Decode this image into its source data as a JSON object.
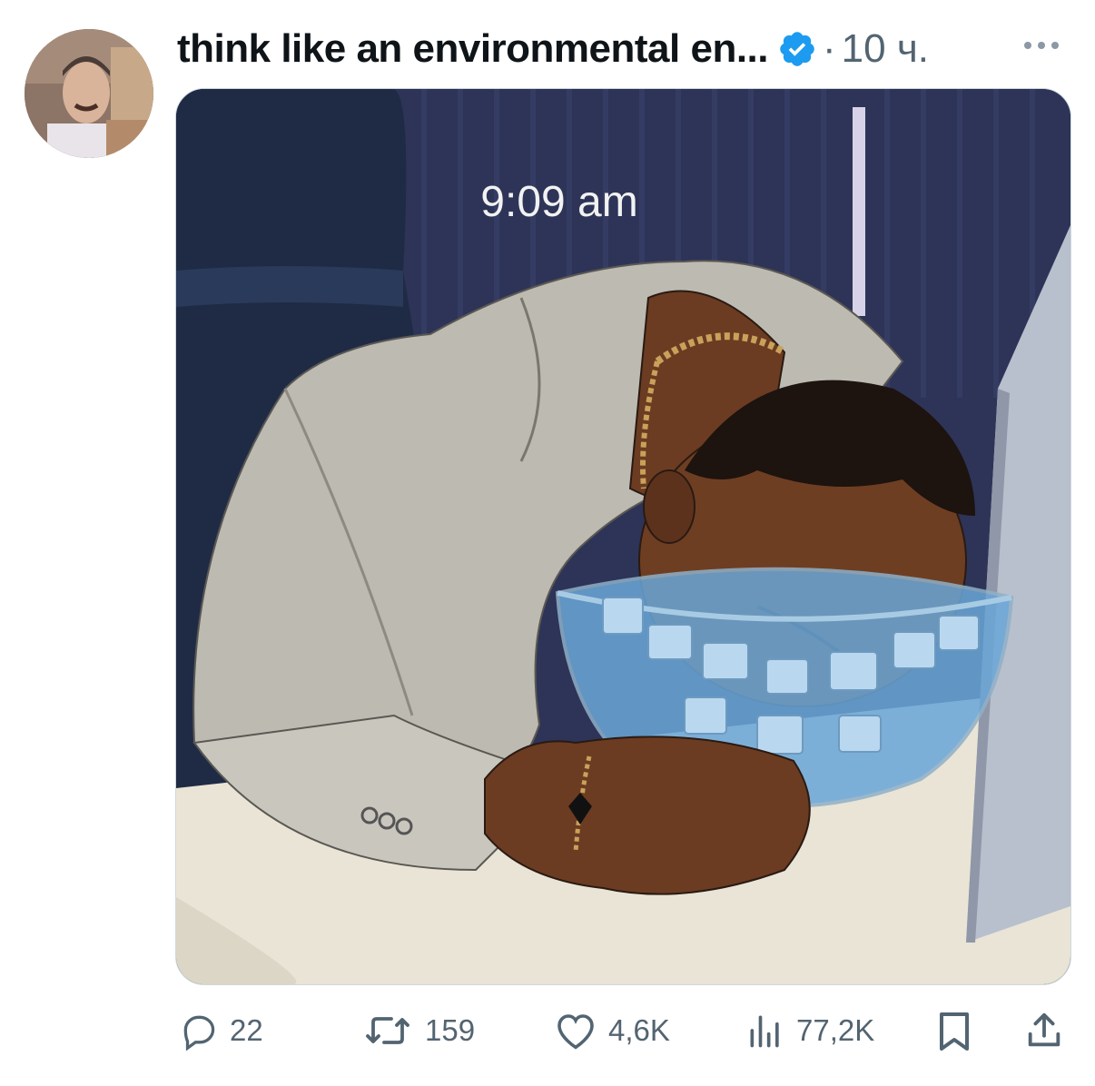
{
  "tweet": {
    "author_name": "think like an environmental en...",
    "verified": true,
    "separator": "·",
    "time_ago": "10 ч.",
    "more_icon": "more-horizontal-icon"
  },
  "media": {
    "overlay_time_text": "9:09 am"
  },
  "actions": {
    "reply_count": "22",
    "retweet_count": "159",
    "like_count": "4,6K",
    "views_count": "77,2K",
    "icons": [
      "reply-icon",
      "retweet-icon",
      "like-icon",
      "views-icon",
      "bookmark-icon",
      "share-icon"
    ]
  },
  "colors": {
    "text_primary": "#0f1419",
    "text_secondary": "#536471",
    "verified_blue": "#1d9bf0"
  }
}
